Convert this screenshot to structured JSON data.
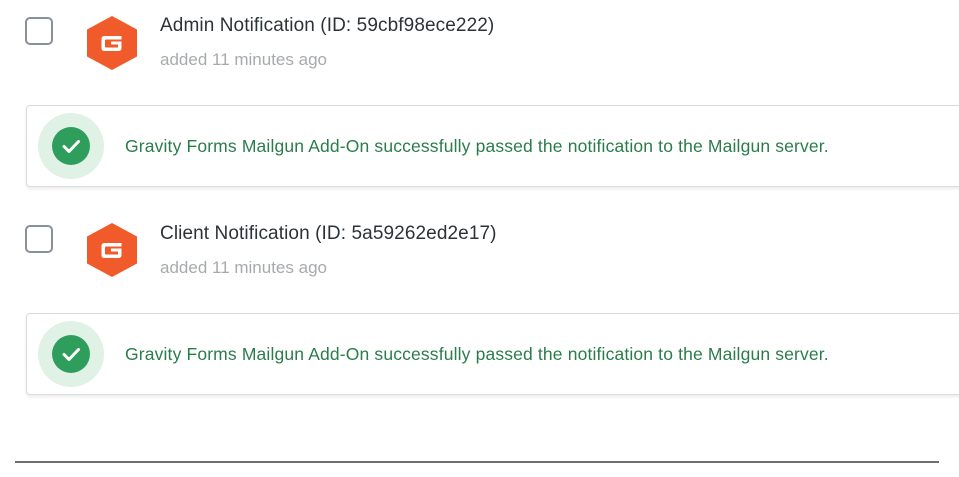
{
  "notifications": [
    {
      "title": "Admin Notification (ID: 59cbf98ece222)",
      "meta": "added 11 minutes ago",
      "notice": "Gravity Forms Mailgun Add-On successfully passed the notification to the Mailgun server."
    },
    {
      "title": "Client Notification (ID: 5a59262ed2e17)",
      "meta": "added 11 minutes ago",
      "notice": "Gravity Forms Mailgun Add-On successfully passed the notification to the Mailgun server."
    }
  ],
  "icons": {
    "logo": "gravity-forms-logo-icon",
    "success": "checkmark-circle-icon"
  },
  "colors": {
    "logo_orange": "#f15a2b",
    "success_green": "#2f9e5c",
    "success_text": "#2a7d4b",
    "success_halo": "#e0f2e6"
  }
}
